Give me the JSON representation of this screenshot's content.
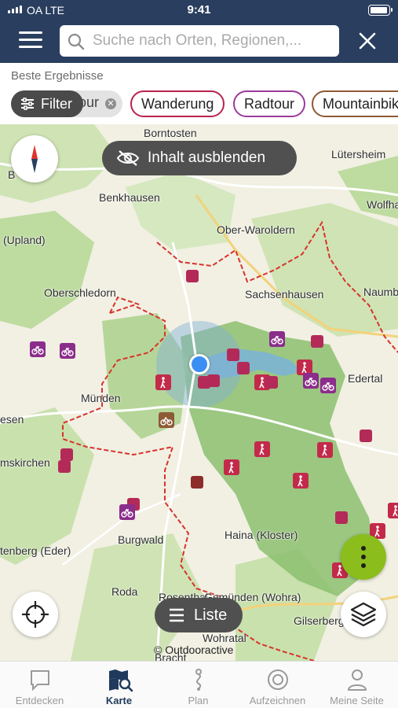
{
  "status_bar": {
    "carrier": "OA  LTE",
    "time": "9:41"
  },
  "header": {
    "search_placeholder": "Suche nach Orten, Regionen,...",
    "icons": {
      "menu": "hamburger-icon",
      "search": "search-icon",
      "close": "close-icon"
    }
  },
  "results_label": "Beste Ergebnisse",
  "filter": {
    "label": "Filter",
    "icon": "sliders-icon"
  },
  "chips": [
    {
      "label": "our",
      "removable": true
    },
    {
      "label": "Wanderung"
    },
    {
      "label": "Radtour"
    },
    {
      "label": "Mountainbike"
    }
  ],
  "map": {
    "hide_button": "Inhalt ausblenden",
    "list_button": "Liste",
    "copyright": "© Outdooractive",
    "places": [
      "Borntosten",
      "Lütersheim",
      "Benkhausen",
      "Wolfha",
      "(Upland)",
      "Ober-Waroldern",
      "Oberschledorn",
      "Sachsenhausen",
      "Naumb",
      "Edertal",
      "Münden",
      "esen",
      "mskirchen",
      "Burgwald",
      "Haina (Kloster)",
      "tenberg (Eder)",
      "Roda",
      "Rosenthal",
      "Gemünden (Wohra)",
      "Gilserberg",
      "Wohratal",
      "Bracht",
      "B"
    ],
    "colors": {
      "boundary": "#d8332c",
      "forest": "#a8cf86",
      "park": "#8cbf6e",
      "poi": "#b32a58",
      "action": "#8bbd1d"
    }
  },
  "tabs": [
    {
      "label": "Entdecken",
      "icon": "chat-bubble-icon",
      "active": false
    },
    {
      "label": "Karte",
      "icon": "map-search-icon",
      "active": true
    },
    {
      "label": "Plan",
      "icon": "route-plan-icon",
      "active": false
    },
    {
      "label": "Aufzeichnen",
      "icon": "record-icon",
      "active": false
    },
    {
      "label": "Meine Seite",
      "icon": "user-icon",
      "active": false
    }
  ]
}
